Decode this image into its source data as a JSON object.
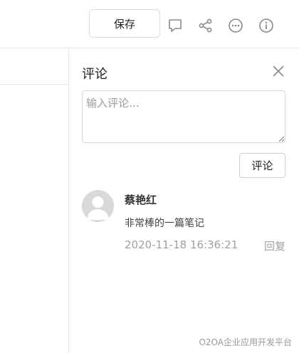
{
  "toolbar": {
    "save_label": "保存",
    "icons": [
      "comment-icon",
      "share-icon",
      "more-icon",
      "info-icon"
    ]
  },
  "comments_panel": {
    "title": "评论",
    "input_placeholder": "输入评论…",
    "submit_label": "评论",
    "comments": [
      {
        "author": "蔡艳红",
        "text": "非常棒的一篇笔记",
        "timestamp": "2020-11-18 16:36:21",
        "reply_label": "回复"
      }
    ]
  },
  "watermark": "O2OA企业应用开发平台",
  "colors": {
    "icon": "#8a8a8a",
    "muted_text": "#a0a0a0",
    "border": "#d6d6d6"
  }
}
